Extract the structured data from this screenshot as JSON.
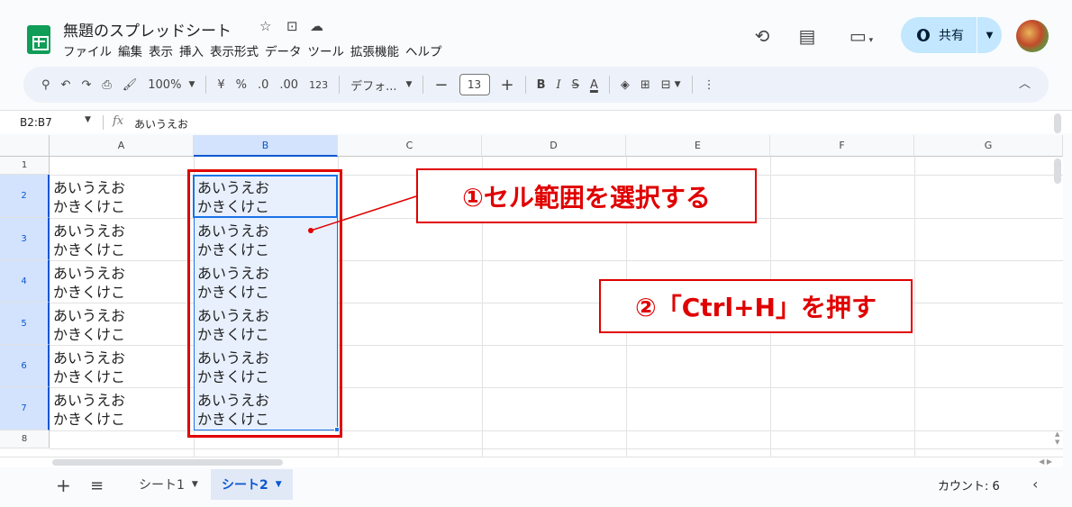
{
  "header": {
    "doc_title": "無題のスプレッドシート",
    "menu": [
      "ファイル",
      "編集",
      "表示",
      "挿入",
      "表示形式",
      "データ",
      "ツール",
      "拡張機能",
      "ヘルプ"
    ],
    "share_label": "共有"
  },
  "toolbar": {
    "zoom": "100%",
    "currency": "¥",
    "percent": "%",
    "dec_decrease": ".0",
    "dec_increase": ".00",
    "number_format": "123",
    "font": "デフォ...",
    "font_size": "13",
    "bold": "B",
    "italic": "I",
    "underline_color": "A"
  },
  "formula_bar": {
    "name_box": "B2:B7",
    "fx": "fx",
    "content": "あいうえお"
  },
  "grid": {
    "columns": [
      "A",
      "B",
      "C",
      "D",
      "E",
      "F",
      "G"
    ],
    "rows": [
      "1",
      "2",
      "3",
      "4",
      "5",
      "6",
      "7",
      "8"
    ],
    "selected_column": "B",
    "selected_range": "B2:B7",
    "cells": {
      "A2": [
        "あいうえお",
        "かきくけこ"
      ],
      "B2": [
        "あいうえお",
        "かきくけこ"
      ],
      "A3": [
        "あいうえお",
        "かきくけこ"
      ],
      "B3": [
        "あいうえお",
        "かきくけこ"
      ],
      "A4": [
        "あいうえお",
        "かきくけこ"
      ],
      "B4": [
        "あいうえお",
        "かきくけこ"
      ],
      "A5": [
        "あいうえお",
        "かきくけこ"
      ],
      "B5": [
        "あいうえお",
        "かきくけこ"
      ],
      "A6": [
        "あいうえお",
        "かきくけこ"
      ],
      "B6": [
        "あいうえお",
        "かきくけこ"
      ],
      "A7": [
        "あいうえお",
        "かきくけこ"
      ],
      "B7": [
        "あいうえお",
        "かきくけこ"
      ]
    }
  },
  "annotations": {
    "step1": "①セル範囲を選択する",
    "step2": "②「Ctrl+H」を押す",
    "accent_color": "#e00000"
  },
  "sheets": {
    "tabs": [
      "シート1",
      "シート2"
    ],
    "active": "シート2",
    "status": "カウント: 6"
  },
  "colors": {
    "selection_border": "#1a73e8",
    "selection_fill": "#e8f0fe",
    "share_bg": "#c2e7ff",
    "toolbar_bg": "#edf2fa"
  }
}
